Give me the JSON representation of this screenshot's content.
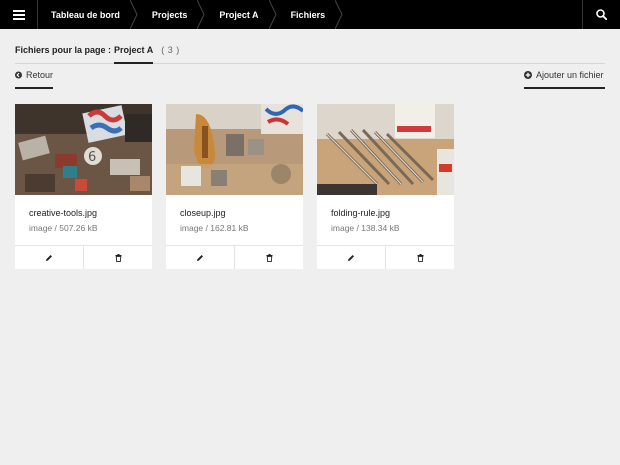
{
  "topbar": {
    "breadcrumbs": [
      "Tableau de bord",
      "Projects",
      "Project A",
      "Fichiers"
    ]
  },
  "heading": {
    "label": "Fichiers pour la page :",
    "page": "Project A",
    "count": "( 3 )"
  },
  "actions": {
    "back_label": "Retour",
    "add_label": "Ajouter un fichier"
  },
  "files": [
    {
      "name": "creative-tools.jpg",
      "meta": "image / 507.26 kB"
    },
    {
      "name": "closeup.jpg",
      "meta": "image / 162.81 kB"
    },
    {
      "name": "folding-rule.jpg",
      "meta": "image / 138.34 kB"
    }
  ],
  "colors": {
    "topbar": "#000000",
    "background": "#efefef",
    "card": "#ffffff"
  }
}
